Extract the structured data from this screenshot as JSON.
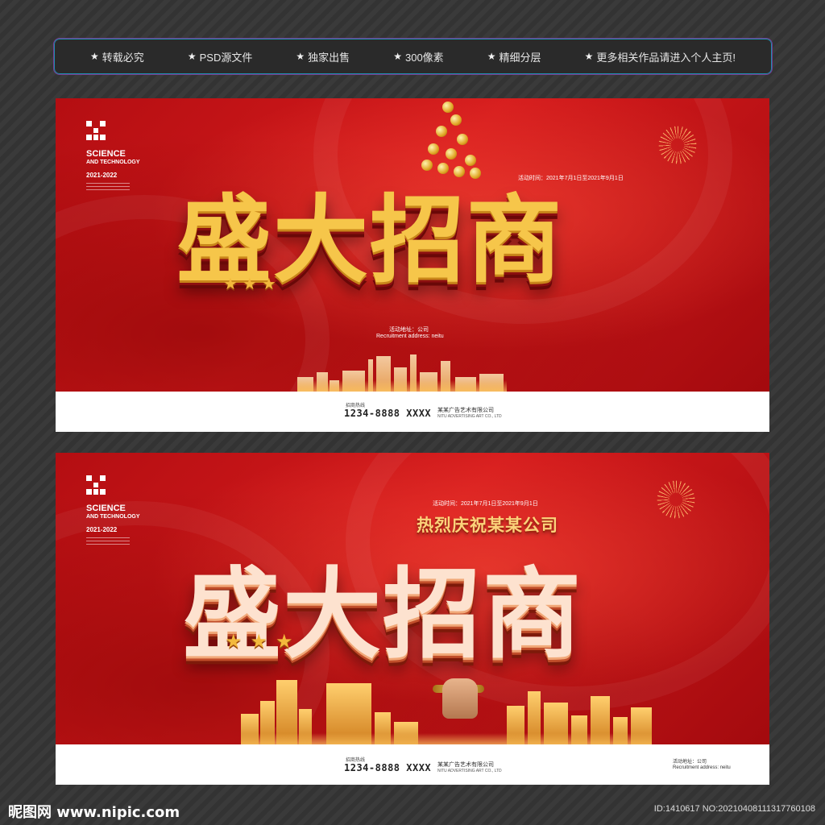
{
  "features": [
    {
      "icon": "★",
      "label": "转载必究"
    },
    {
      "icon": "★",
      "label": "PSD源文件"
    },
    {
      "icon": "★",
      "label": "独家出售"
    },
    {
      "icon": "★",
      "label": "300像素"
    },
    {
      "icon": "★",
      "label": "精细分层"
    },
    {
      "icon": "★",
      "label": "更多相关作品请进入个人主页!"
    }
  ],
  "logo": {
    "title": "SCIENCE",
    "subtitle": "AND TECHNOLOGY",
    "year": "2021-2022"
  },
  "banner1": {
    "headline": "盛大招商",
    "activity_time": "活动时间：2021年7月1日至2021年9月1日",
    "address_cn": "活动地址：公司",
    "address_en": "Recruitment address: neitu",
    "stars": "★★★",
    "phone_label": "招商热线",
    "phone": "1234-8888 XXXX",
    "company_cn": "某某广告艺术有限公司",
    "company_en": "NITU ADVERTISING ART CO., LTD"
  },
  "banner2": {
    "headline": "盛大招商",
    "subtitle": "热烈庆祝某某公司",
    "activity_time": "活动时间：2021年7月1日至2021年9月1日",
    "stars": "★★★",
    "phone_label": "招商热线",
    "phone": "1234-8888 XXXX",
    "company_cn": "某某广告艺术有限公司",
    "company_en": "NITU ADVERTISING ART CO., LTD",
    "address_cn": "活动地址：公司",
    "address_en": "Recruitment address: neitu"
  },
  "watermark": {
    "site": "昵图网 www.nipic.com",
    "id": "ID:1410617 NO:20210408111317760108"
  },
  "colors": {
    "banner_red": "#d41a1c",
    "gold": "#f6c64a",
    "frame_purple": "#7a3b8f",
    "frame_cyan": "#1e8fb0"
  }
}
